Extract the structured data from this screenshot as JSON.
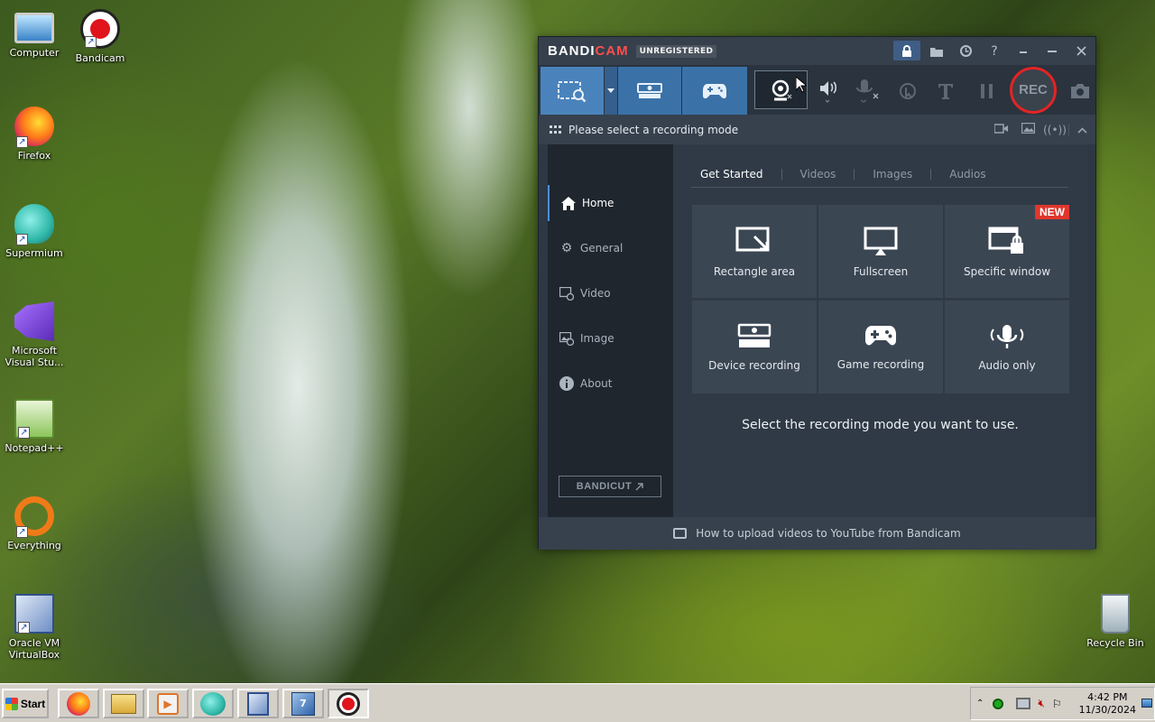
{
  "desktop": {
    "icons": [
      {
        "label": "Computer",
        "icon": "computer-icon"
      },
      {
        "label": "Bandicam",
        "icon": "bandicam-icon"
      },
      {
        "label": "Firefox",
        "icon": "firefox-icon"
      },
      {
        "label": "Supermium",
        "icon": "supermium-icon"
      },
      {
        "label": "Microsoft Visual Stu...",
        "icon": "visual-studio-icon"
      },
      {
        "label": "Notepad++",
        "icon": "notepad-plus-plus-icon"
      },
      {
        "label": "Everything",
        "icon": "everything-icon"
      },
      {
        "label": "Oracle VM VirtualBox",
        "icon": "virtualbox-icon"
      },
      {
        "label": "Recycle Bin",
        "icon": "recycle-bin-icon"
      }
    ]
  },
  "bandicam": {
    "brand_main": "BANDI",
    "brand_accent": "CAM",
    "unregistered": "UNREGISTERED",
    "modebar_title": "Please select a recording mode",
    "rec_label": "REC",
    "sidebar": {
      "items": [
        {
          "label": "Home",
          "icon": "home-icon"
        },
        {
          "label": "General",
          "icon": "gear-icon"
        },
        {
          "label": "Video",
          "icon": "video-settings-icon"
        },
        {
          "label": "Image",
          "icon": "image-settings-icon"
        },
        {
          "label": "About",
          "icon": "info-icon"
        }
      ],
      "bandicut": "BANDICUT"
    },
    "tabs": [
      "Get Started",
      "Videos",
      "Images",
      "Audios"
    ],
    "tiles": [
      {
        "label": "Rectangle area",
        "icon": "rectangle-area-icon"
      },
      {
        "label": "Fullscreen",
        "icon": "monitor-icon"
      },
      {
        "label": "Specific window",
        "icon": "locked-window-icon",
        "badge": "NEW"
      },
      {
        "label": "Device recording",
        "icon": "hdmi-icon"
      },
      {
        "label": "Game recording",
        "icon": "gamepad-icon"
      },
      {
        "label": "Audio only",
        "icon": "microphone-icon"
      }
    ],
    "hint": "Select the recording mode you want to use.",
    "footer": "How to upload videos to YouTube from Bandicam",
    "colors": {
      "mode_active": "#4a83bc",
      "rec_ring": "#e32424",
      "new_badge": "#e0362c"
    }
  },
  "taskbar": {
    "start": "Start",
    "clock_time": "4:42 PM",
    "clock_date": "11/30/2024"
  }
}
